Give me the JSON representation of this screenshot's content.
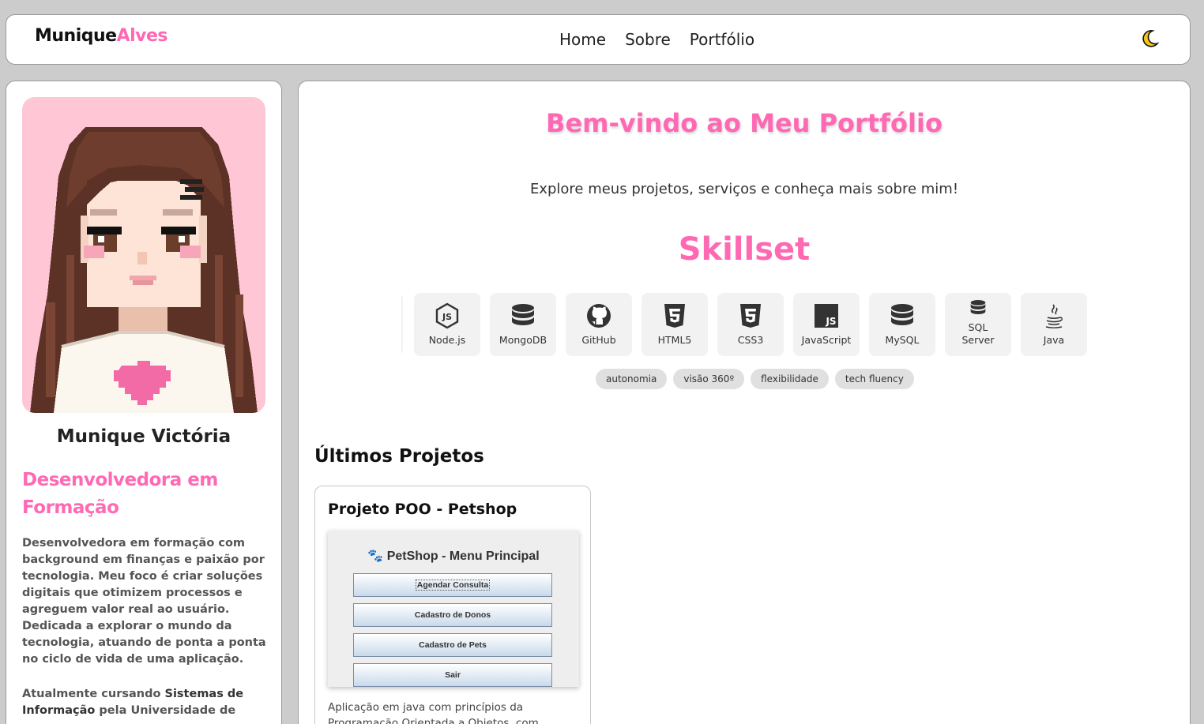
{
  "navbar": {
    "logo_first": "Munique",
    "logo_last": "Alves",
    "links": [
      "Home",
      "Sobre",
      "Portfólio"
    ],
    "theme_icon": "moon-icon"
  },
  "profile": {
    "avatar": "pixel-art-avatar",
    "name": "Munique Victória",
    "role": "Desenvolvedora em Formação",
    "bio": "Desenvolvedora em formação com background em finanças e paixão por tecnologia. Meu foco é criar soluções digitais que otimizem processos e agreguem valor real ao usuário. Dedicada a explorar o mundo da tecnologia, atuando de ponta a ponta no ciclo de vida de uma aplicação.",
    "bio2_prefix": "Atualmente cursando ",
    "bio2_course": "Sistemas de Informação",
    "bio2_suffix": " pela Universidade de"
  },
  "main": {
    "welcome_title": "Bem-vindo ao Meu Portfólio",
    "welcome_subtitle": "Explore meus projetos, serviços e conheça mais sobre mim!",
    "skills_title": "Skillset",
    "skills": [
      {
        "label": "Node.js",
        "icon": "nodejs-icon"
      },
      {
        "label": "MongoDB",
        "icon": "database-icon"
      },
      {
        "label": "GitHub",
        "icon": "github-icon"
      },
      {
        "label": "HTML5",
        "icon": "html5-icon"
      },
      {
        "label": "CSS3",
        "icon": "css3-icon"
      },
      {
        "label": "JavaScript",
        "icon": "javascript-icon"
      },
      {
        "label": "MySQL",
        "icon": "database-icon"
      },
      {
        "label": "SQL Server",
        "icon": "database-icon"
      },
      {
        "label": "Java",
        "icon": "java-icon"
      }
    ],
    "tags": [
      "autonomia",
      "visão 360º",
      "flexibilidade",
      "tech fluency"
    ],
    "projects_title": "Últimos Projetos",
    "project": {
      "name": "Projeto POO - Petshop",
      "screenshot_title": "🐾 PetShop - Menu Principal",
      "screenshot_buttons": [
        "Agendar Consulta",
        "Cadastro de Donos",
        "Cadastro de Pets",
        "Sair"
      ],
      "description": "Aplicação em java com princípios da Programação Orientada a Objetos, com"
    }
  },
  "colors": {
    "accent": "#ff69b4",
    "background": "#cccccc",
    "avatar_bg": "#ffc6d5"
  }
}
